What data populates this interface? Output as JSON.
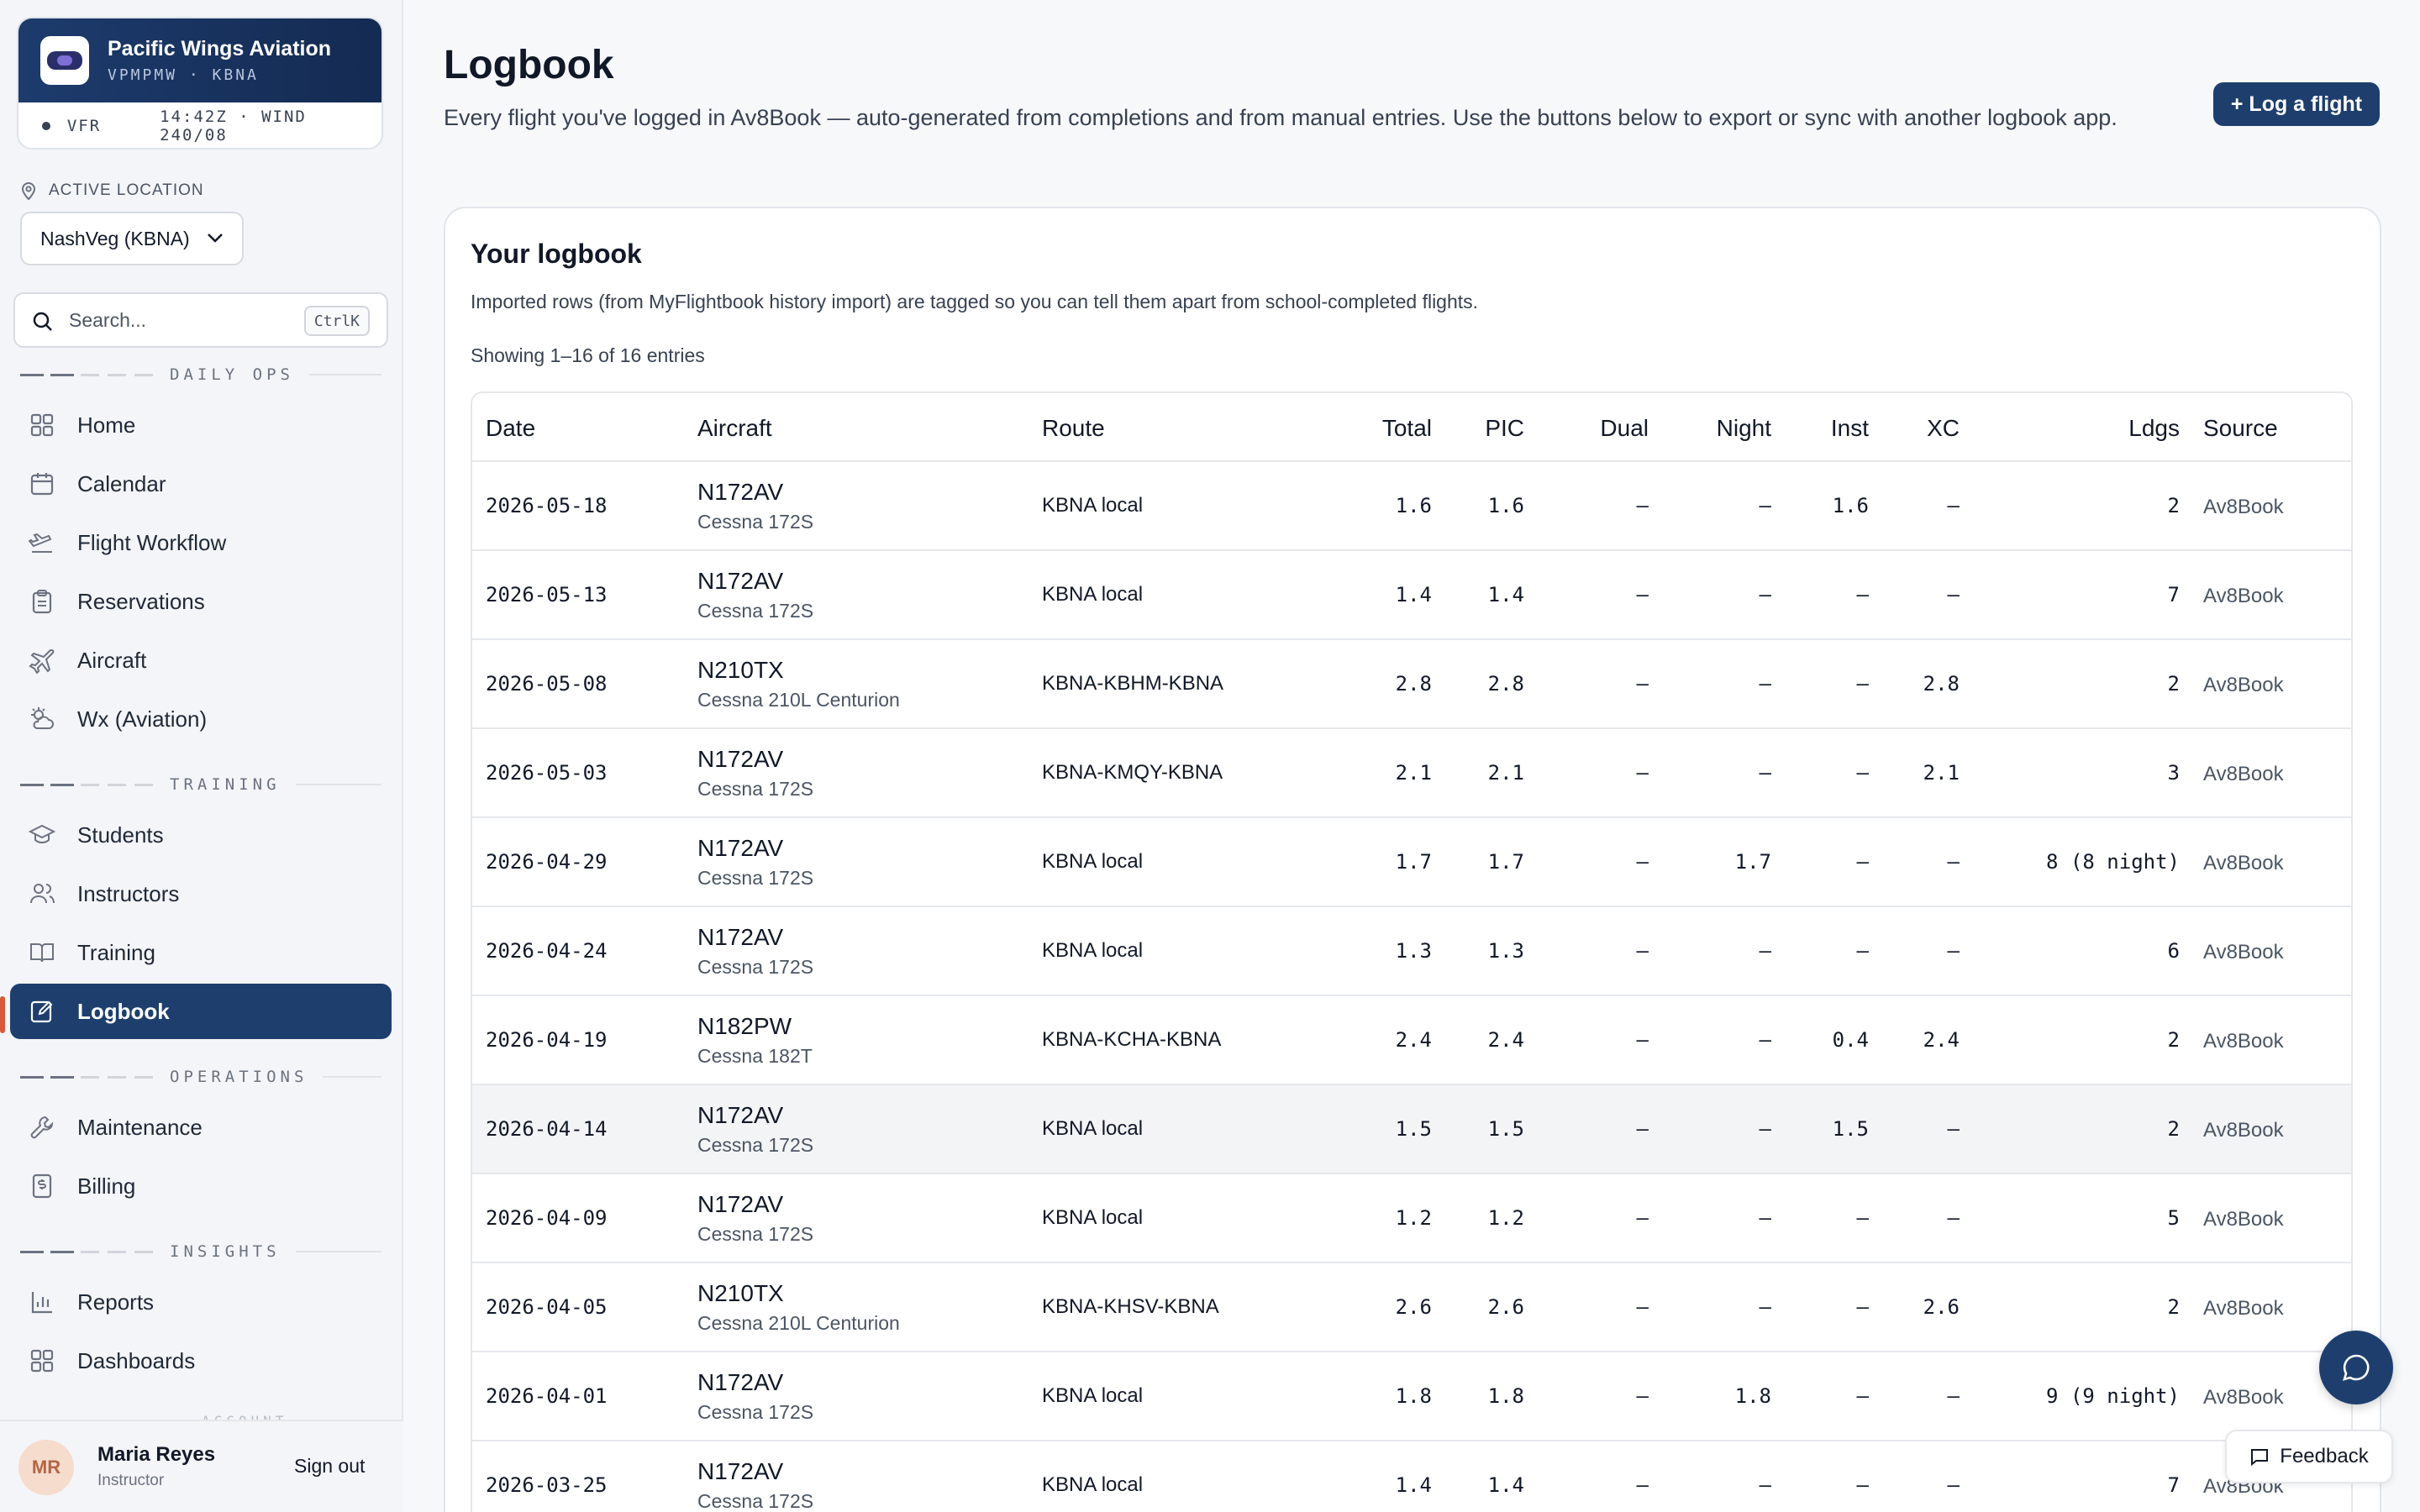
{
  "brand": {
    "name": "Pacific Wings Aviation",
    "code": "VPMPMW · KBNA",
    "flight_rules": "VFR",
    "time_wind": "14:42Z · WIND 240/08"
  },
  "location": {
    "label": "ACTIVE LOCATION",
    "value": "NashVeg (KBNA)"
  },
  "search": {
    "placeholder": "Search...",
    "shortcut": "CtrlK"
  },
  "sections": {
    "daily_ops": "DAILY OPS",
    "training": "TRAINING",
    "operations": "OPERATIONS",
    "insights": "INSIGHTS",
    "account": "ACCOUNT"
  },
  "nav": {
    "home": "Home",
    "calendar": "Calendar",
    "flight_workflow": "Flight Workflow",
    "reservations": "Reservations",
    "aircraft": "Aircraft",
    "wx": "Wx (Aviation)",
    "students": "Students",
    "instructors": "Instructors",
    "training": "Training",
    "logbook": "Logbook",
    "maintenance": "Maintenance",
    "billing": "Billing",
    "reports": "Reports",
    "dashboards": "Dashboards"
  },
  "user": {
    "initials": "MR",
    "name": "Maria Reyes",
    "role": "Instructor",
    "signout": "Sign out"
  },
  "page": {
    "title": "Logbook",
    "description": "Every flight you've logged in Av8Book — auto-generated from completions and from manual entries. Use the buttons below to export or sync with another logbook app.",
    "log_button": "+ Log a flight"
  },
  "card": {
    "title": "Your logbook",
    "description": "Imported rows (from MyFlightbook history import) are tagged so you can tell them apart from school-completed flights.",
    "count": "Showing 1–16 of 16 entries"
  },
  "table": {
    "headers": {
      "date": "Date",
      "aircraft": "Aircraft",
      "route": "Route",
      "total": "Total",
      "pic": "PIC",
      "dual": "Dual",
      "night": "Night",
      "inst": "Inst",
      "xc": "XC",
      "ldgs": "Ldgs",
      "source": "Source"
    },
    "rows": [
      {
        "date": "2026-05-18",
        "tail": "N172AV",
        "model": "Cessna 172S",
        "route": "KBNA local",
        "total": "1.6",
        "pic": "1.6",
        "dual": "—",
        "night": "—",
        "inst": "1.6",
        "xc": "—",
        "ldgs": "2",
        "source": "Av8Book"
      },
      {
        "date": "2026-05-13",
        "tail": "N172AV",
        "model": "Cessna 172S",
        "route": "KBNA local",
        "total": "1.4",
        "pic": "1.4",
        "dual": "—",
        "night": "—",
        "inst": "—",
        "xc": "—",
        "ldgs": "7",
        "source": "Av8Book"
      },
      {
        "date": "2026-05-08",
        "tail": "N210TX",
        "model": "Cessna 210L Centurion",
        "route": "KBNA-KBHM-KBNA",
        "total": "2.8",
        "pic": "2.8",
        "dual": "—",
        "night": "—",
        "inst": "—",
        "xc": "2.8",
        "ldgs": "2",
        "source": "Av8Book"
      },
      {
        "date": "2026-05-03",
        "tail": "N172AV",
        "model": "Cessna 172S",
        "route": "KBNA-KMQY-KBNA",
        "total": "2.1",
        "pic": "2.1",
        "dual": "—",
        "night": "—",
        "inst": "—",
        "xc": "2.1",
        "ldgs": "3",
        "source": "Av8Book"
      },
      {
        "date": "2026-04-29",
        "tail": "N172AV",
        "model": "Cessna 172S",
        "route": "KBNA local",
        "total": "1.7",
        "pic": "1.7",
        "dual": "—",
        "night": "1.7",
        "inst": "—",
        "xc": "—",
        "ldgs": "8 (8 night)",
        "source": "Av8Book"
      },
      {
        "date": "2026-04-24",
        "tail": "N172AV",
        "model": "Cessna 172S",
        "route": "KBNA local",
        "total": "1.3",
        "pic": "1.3",
        "dual": "—",
        "night": "—",
        "inst": "—",
        "xc": "—",
        "ldgs": "6",
        "source": "Av8Book"
      },
      {
        "date": "2026-04-19",
        "tail": "N182PW",
        "model": "Cessna 182T",
        "route": "KBNA-KCHA-KBNA",
        "total": "2.4",
        "pic": "2.4",
        "dual": "—",
        "night": "—",
        "inst": "0.4",
        "xc": "2.4",
        "ldgs": "2",
        "source": "Av8Book"
      },
      {
        "date": "2026-04-14",
        "tail": "N172AV",
        "model": "Cessna 172S",
        "route": "KBNA local",
        "total": "1.5",
        "pic": "1.5",
        "dual": "—",
        "night": "—",
        "inst": "1.5",
        "xc": "—",
        "ldgs": "2",
        "source": "Av8Book"
      },
      {
        "date": "2026-04-09",
        "tail": "N172AV",
        "model": "Cessna 172S",
        "route": "KBNA local",
        "total": "1.2",
        "pic": "1.2",
        "dual": "—",
        "night": "—",
        "inst": "—",
        "xc": "—",
        "ldgs": "5",
        "source": "Av8Book"
      },
      {
        "date": "2026-04-05",
        "tail": "N210TX",
        "model": "Cessna 210L Centurion",
        "route": "KBNA-KHSV-KBNA",
        "total": "2.6",
        "pic": "2.6",
        "dual": "—",
        "night": "—",
        "inst": "—",
        "xc": "2.6",
        "ldgs": "2",
        "source": "Av8Book"
      },
      {
        "date": "2026-04-01",
        "tail": "N172AV",
        "model": "Cessna 172S",
        "route": "KBNA local",
        "total": "1.8",
        "pic": "1.8",
        "dual": "—",
        "night": "1.8",
        "inst": "—",
        "xc": "—",
        "ldgs": "9 (9 night)",
        "source": "Av8Book"
      },
      {
        "date": "2026-03-25",
        "tail": "N172AV",
        "model": "Cessna 172S",
        "route": "KBNA local",
        "total": "1.4",
        "pic": "1.4",
        "dual": "—",
        "night": "—",
        "inst": "—",
        "xc": "—",
        "ldgs": "7",
        "source": "Av8Book"
      }
    ]
  },
  "floating": {
    "feedback": "Feedback"
  },
  "colors": {
    "primary": "#1e3f6e",
    "accent": "#d9593a"
  }
}
